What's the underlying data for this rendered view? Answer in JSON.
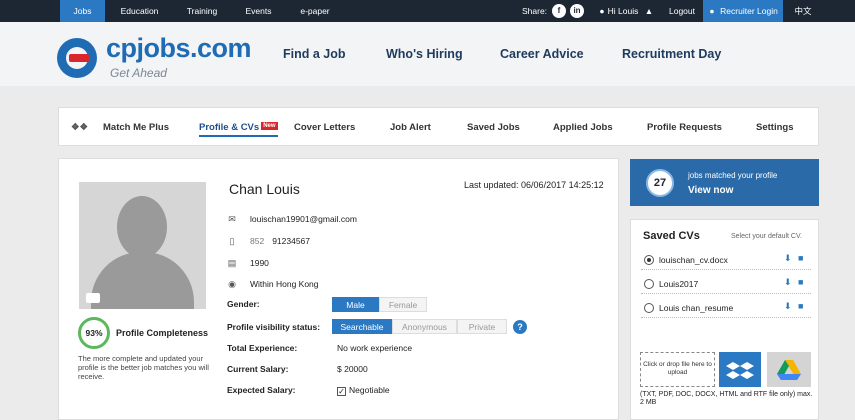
{
  "topbar": {
    "tabs": [
      "Jobs",
      "Education",
      "Training",
      "Events",
      "e-paper"
    ],
    "share_label": "Share:",
    "user": "Hi Louis",
    "logout": "Logout",
    "recruiter": "Recruiter Login",
    "language": "中文"
  },
  "header": {
    "logo": "cpjobs.com",
    "tagline": "Get Ahead",
    "nav": [
      "Find a Job",
      "Who's Hiring",
      "Career Advice",
      "Recruitment Day"
    ]
  },
  "subnav": {
    "items": [
      "Match Me Plus",
      "Profile & CVs",
      "Cover Letters",
      "Job Alert",
      "Saved Jobs",
      "Applied Jobs",
      "Profile Requests",
      "Settings"
    ],
    "new_badge": "New"
  },
  "profile": {
    "name": "Chan  Louis",
    "last_updated": "Last updated: 06/06/2017 14:25:12",
    "email": "louischan19901@gmail.com",
    "phone_code": "852",
    "phone": "91234567",
    "birth_year": "1990",
    "location": "Within Hong Kong",
    "completeness": "93%",
    "completeness_label": "Profile Completeness",
    "completeness_note": "The more complete and updated your profile is the better job matches you will receive."
  },
  "fields": {
    "gender_label": "Gender:",
    "gender_options": [
      "Male",
      "Female"
    ],
    "visibility_label": "Profile visibility status:",
    "visibility_options": [
      "Searchable",
      "Anonymous",
      "Private"
    ],
    "experience_label": "Total Experience:",
    "experience_value": "No work experience",
    "salary_label": "Current Salary:",
    "salary_value": "$ 20000",
    "expected_label": "Expected Salary:",
    "expected_value": "Negotiable"
  },
  "jobs_match": {
    "count": "27",
    "text": "jobs matched your profile",
    "link": "View now"
  },
  "saved_cvs": {
    "title": "Saved CVs",
    "hint": "Select your default CV.",
    "items": [
      "louischan_cv.docx",
      "Louis2017",
      "Louis chan_resume"
    ],
    "upload": "Click or drop file here to upload",
    "file_types": "(TXT, PDF, DOC, DOCX, HTML and RTF file only) max. 2 MB"
  },
  "colors": {
    "topbar": "#1d2733",
    "accent": "#2a79c2",
    "brand": "#1f6cb5",
    "logo_red": "#d8262c",
    "progress": "#5cb85c"
  }
}
